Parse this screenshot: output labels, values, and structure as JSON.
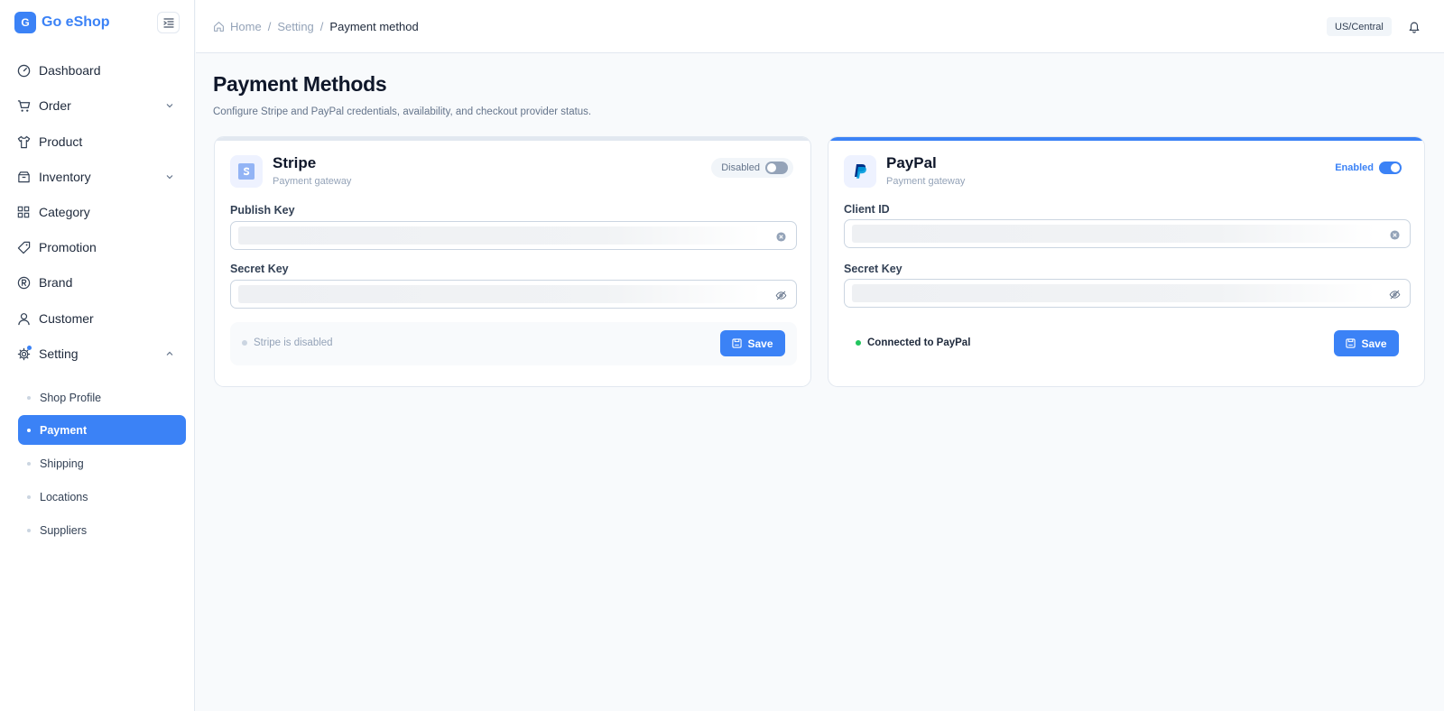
{
  "brand": {
    "logo_letter": "G",
    "name": "Go eShop"
  },
  "sidebar": {
    "items": [
      {
        "label": "Dashboard",
        "icon": "dashboard-icon"
      },
      {
        "label": "Order",
        "icon": "cart-icon",
        "has_chevron": true
      },
      {
        "label": "Product",
        "icon": "shirt-icon"
      },
      {
        "label": "Inventory",
        "icon": "box-icon",
        "has_chevron": true
      },
      {
        "label": "Category",
        "icon": "grid-icon"
      },
      {
        "label": "Promotion",
        "icon": "tag-icon"
      },
      {
        "label": "Brand",
        "icon": "registered-icon"
      },
      {
        "label": "Customer",
        "icon": "user-icon"
      },
      {
        "label": "Setting",
        "icon": "gear-icon",
        "has_chevron": true,
        "expanded": true
      }
    ],
    "sub_items": [
      {
        "label": "Shop Profile",
        "active": false
      },
      {
        "label": "Payment",
        "active": true
      },
      {
        "label": "Shipping",
        "active": false
      },
      {
        "label": "Locations",
        "active": false
      },
      {
        "label": "Suppliers",
        "active": false
      }
    ]
  },
  "header": {
    "breadcrumb": [
      "Home",
      "Setting",
      "Payment method"
    ],
    "timezone": "US/Central"
  },
  "main": {
    "title": "Payment Methods",
    "subtitle": "Configure Stripe and PayPal credentials, availability, and checkout provider status."
  },
  "stripe": {
    "name": "Stripe",
    "type": "Payment gateway",
    "toggle_label": "Disabled",
    "enabled": false,
    "field1_label": "Publish Key",
    "field1_value": "",
    "field2_label": "Secret Key",
    "field2_value": "",
    "status_text": "Stripe is disabled",
    "save_label": "Save"
  },
  "paypal": {
    "name": "PayPal",
    "type": "Payment gateway",
    "toggle_label": "Enabled",
    "enabled": true,
    "field1_label": "Client ID",
    "field1_value": "",
    "field2_label": "Secret Key",
    "field2_value": "",
    "status_text": "Connected to PayPal",
    "save_label": "Save"
  },
  "colors": {
    "accent": "#3b82f6",
    "success": "#22c55e",
    "paypal_blue": "#003087",
    "paypal_light": "#009cde"
  }
}
